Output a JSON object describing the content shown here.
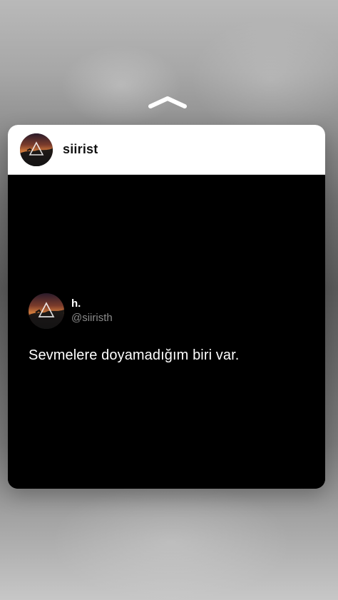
{
  "header": {
    "username": "siirist"
  },
  "tweet": {
    "display_name": "h.",
    "handle": "@siiristh",
    "text": "Sevmelere doyamadığım biri var."
  },
  "icons": {
    "grabber": "chevron-up-icon",
    "avatar": "avatar"
  }
}
